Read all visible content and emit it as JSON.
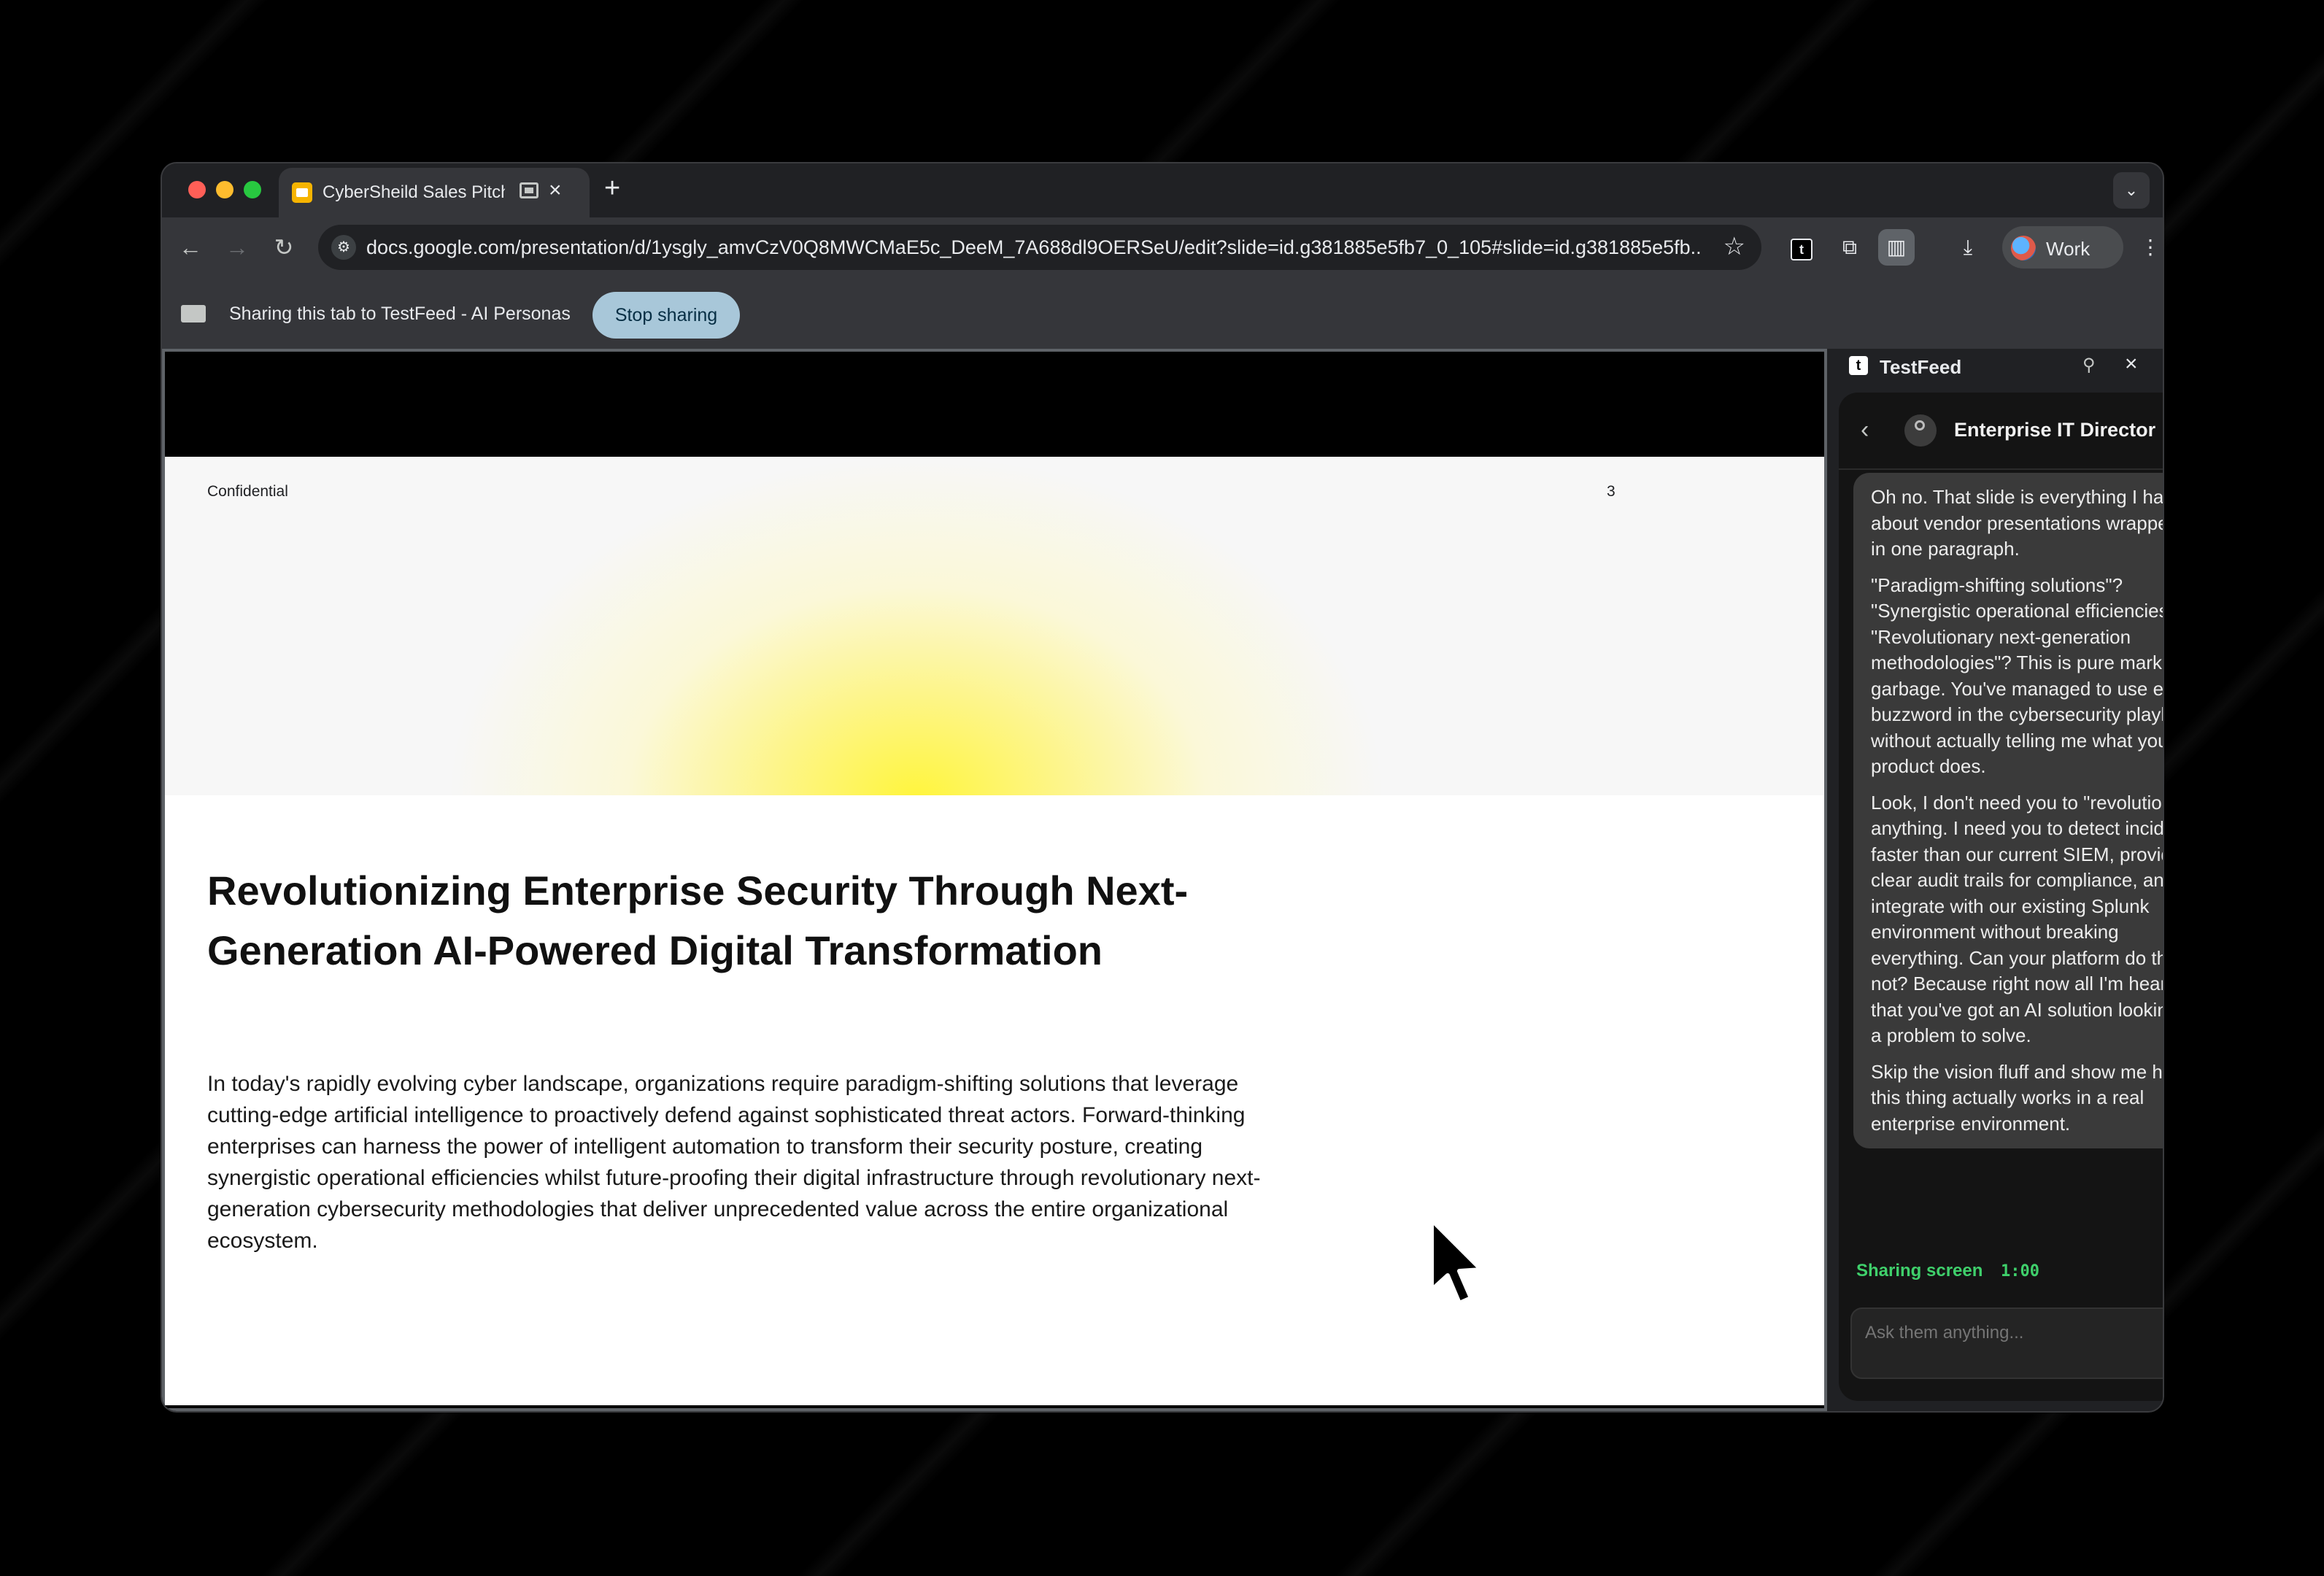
{
  "browser": {
    "tab_title": "CyberSheild Sales Pitch -",
    "url": "docs.google.com/presentation/d/1ysgly_amvCzV0Q8MWCMaE5c_DeeM_7A688dl9OERSeU/edit?slide=id.g381885e5fb7_0_105#slide=id.g381885e5fb...",
    "profile_label": "Work",
    "colors": {
      "traffic_red": "#ff5f57",
      "traffic_yellow": "#febc2e",
      "traffic_green": "#28c840"
    }
  },
  "sharebar": {
    "text": "Sharing this tab to TestFeed - AI Personas",
    "stop_label": "Stop sharing"
  },
  "slide": {
    "confidential": "Confidential",
    "page_number": "3",
    "heading": "Revolutionizing Enterprise Security Through Next-Generation AI-Powered Digital Transformation",
    "body": "In today's rapidly evolving cyber landscape, organizations require paradigm-shifting solutions that leverage cutting-edge artificial intelligence to proactively defend against sophisticated threat actors. Forward-thinking enterprises can harness the power of intelligent automation to transform their security posture, creating synergistic operational efficiencies whilst future-proofing their digital infrastructure through revolutionary next-generation cybersecurity methodologies that deliver unprecedented value across the entire organizational ecosystem."
  },
  "panel": {
    "app_name": "TestFeed",
    "persona": "Enterprise IT Director",
    "messages": [
      "Oh no. That slide is everything I hate about vendor presentations wrapped up in one paragraph.",
      "\"Paradigm-shifting solutions\"? \"Synergistic operational efficiencies\"? \"Revolutionary next-generation methodologies\"? This is pure marketing garbage. You've managed to use every buzzword in the cybersecurity playbook without actually telling me what your product does.",
      "Look, I don't need you to \"revolutionize\" anything. I need you to detect incidents faster than our current SIEM, provide clear audit trails for compliance, and integrate with our existing Splunk environment without breaking everything. Can your platform do that or not? Because right now all I'm hearing is that you've got an AI solution looking for a problem to solve.",
      "Skip the vision fluff and show me how this thing actually works in a real enterprise environment."
    ],
    "status_label": "Sharing screen",
    "timer": "1:00",
    "input_placeholder": "Ask them anything...",
    "accent_color": "#3fd06b"
  }
}
